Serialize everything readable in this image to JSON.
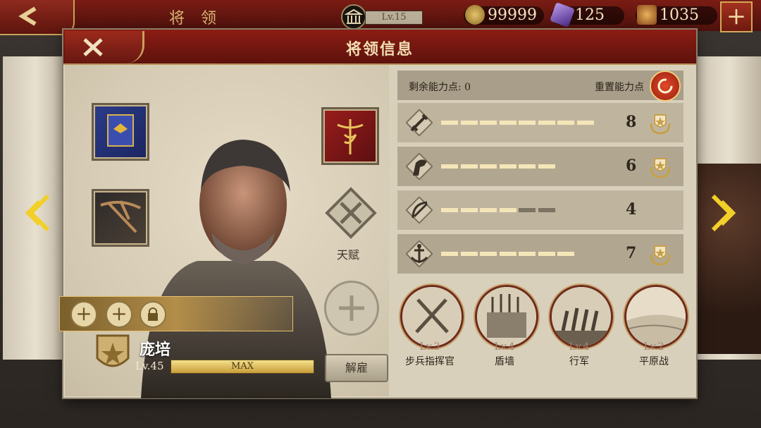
{
  "topbar": {
    "title": "将 领",
    "level": "Lv.15",
    "gold": "99999",
    "gems": "125",
    "spqr": "1035",
    "plus": "+"
  },
  "panel": {
    "title": "将领信息",
    "talent_label": "天赋",
    "dismiss_label": "解雇"
  },
  "hero": {
    "name": "庞培",
    "level": "Lv.45",
    "exp_text": "MAX"
  },
  "attributes": {
    "remaining_label": "剩余能力点:",
    "remaining_value": "0",
    "reset_label": "重置能力点",
    "rows": [
      {
        "icon": "sword-icon",
        "value": "8",
        "filled": 8,
        "total": 8,
        "medal": true
      },
      {
        "icon": "horse-icon",
        "value": "6",
        "filled": 6,
        "total": 6,
        "medal": true
      },
      {
        "icon": "bow-icon",
        "value": "4",
        "filled": 4,
        "total": 6,
        "medal": false
      },
      {
        "icon": "anchor-icon",
        "value": "7",
        "filled": 7,
        "total": 7,
        "medal": true
      }
    ]
  },
  "skills": [
    {
      "level": "Lv.3",
      "name": "步兵指挥官",
      "icon": "crossed-swords-icon"
    },
    {
      "level": "Lv.4",
      "name": "盾墙",
      "icon": "shield-wall-icon"
    },
    {
      "level": "Lv.4",
      "name": "行军",
      "icon": "march-icon"
    },
    {
      "level": "Lv.2",
      "name": "平原战",
      "icon": "plains-icon"
    }
  ],
  "colors": {
    "accent_red": "#8b1d14",
    "gold": "#d8b674",
    "bar_fill": "#f4e6b8",
    "bar_empty": "#7d7362"
  }
}
